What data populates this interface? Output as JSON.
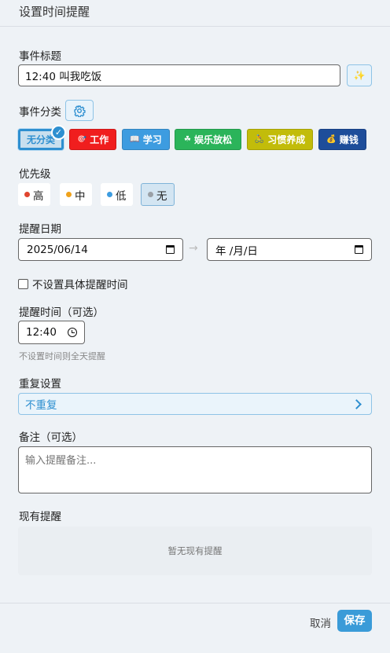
{
  "dialog": {
    "title": "设置时间提醒"
  },
  "event_title": {
    "label": "事件标题",
    "value": "12:40 叫我吃饭",
    "magic_icon": "sparkles-icon"
  },
  "category": {
    "label": "事件分类",
    "settings_icon": "gear-icon",
    "items": [
      {
        "label": "无分类",
        "icon": "",
        "color": "#c9dfee",
        "text_color": "#2e8fd0",
        "selected": true
      },
      {
        "label": "工作",
        "icon": "🎯",
        "color": "#f01e1e",
        "text_color": "#ffffff",
        "selected": false
      },
      {
        "label": "学习",
        "icon": "📖",
        "color": "#3d9ce0",
        "text_color": "#ffffff",
        "selected": false
      },
      {
        "label": "娱乐放松",
        "icon": "☘",
        "color": "#2bb45a",
        "text_color": "#ffffff",
        "selected": false
      },
      {
        "label": "习惯养成",
        "icon": "🚴",
        "color": "#c2bc0a",
        "text_color": "#ffffff",
        "selected": false
      },
      {
        "label": "赚钱",
        "icon": "💰",
        "color": "#1e4d9a",
        "text_color": "#ffffff",
        "selected": false
      }
    ]
  },
  "priority": {
    "label": "优先级",
    "items": [
      {
        "label": "高",
        "color": "#e0452f",
        "active": false
      },
      {
        "label": "中",
        "color": "#f0a21b",
        "active": false
      },
      {
        "label": "低",
        "color": "#3d9ce0",
        "active": false
      },
      {
        "label": "无",
        "color": "#9aa0a6",
        "active": true
      }
    ]
  },
  "date": {
    "label": "提醒日期",
    "start_value": "2025/06/14",
    "end_value": "年 /月/日",
    "arrow": "→"
  },
  "no_specific_time": {
    "label": "不设置具体提醒时间",
    "checked": false
  },
  "time": {
    "label": "提醒时间（可选）",
    "value": "12:40",
    "hint": "不设置时间则全天提醒"
  },
  "repeat": {
    "label": "重复设置",
    "value": "不重复"
  },
  "notes": {
    "label": "备注（可选）",
    "placeholder": "输入提醒备注..."
  },
  "existing": {
    "label": "现有提醒",
    "empty_text": "暂无现有提醒"
  },
  "footer": {
    "cancel_label": "取消",
    "save_label": "保存"
  }
}
